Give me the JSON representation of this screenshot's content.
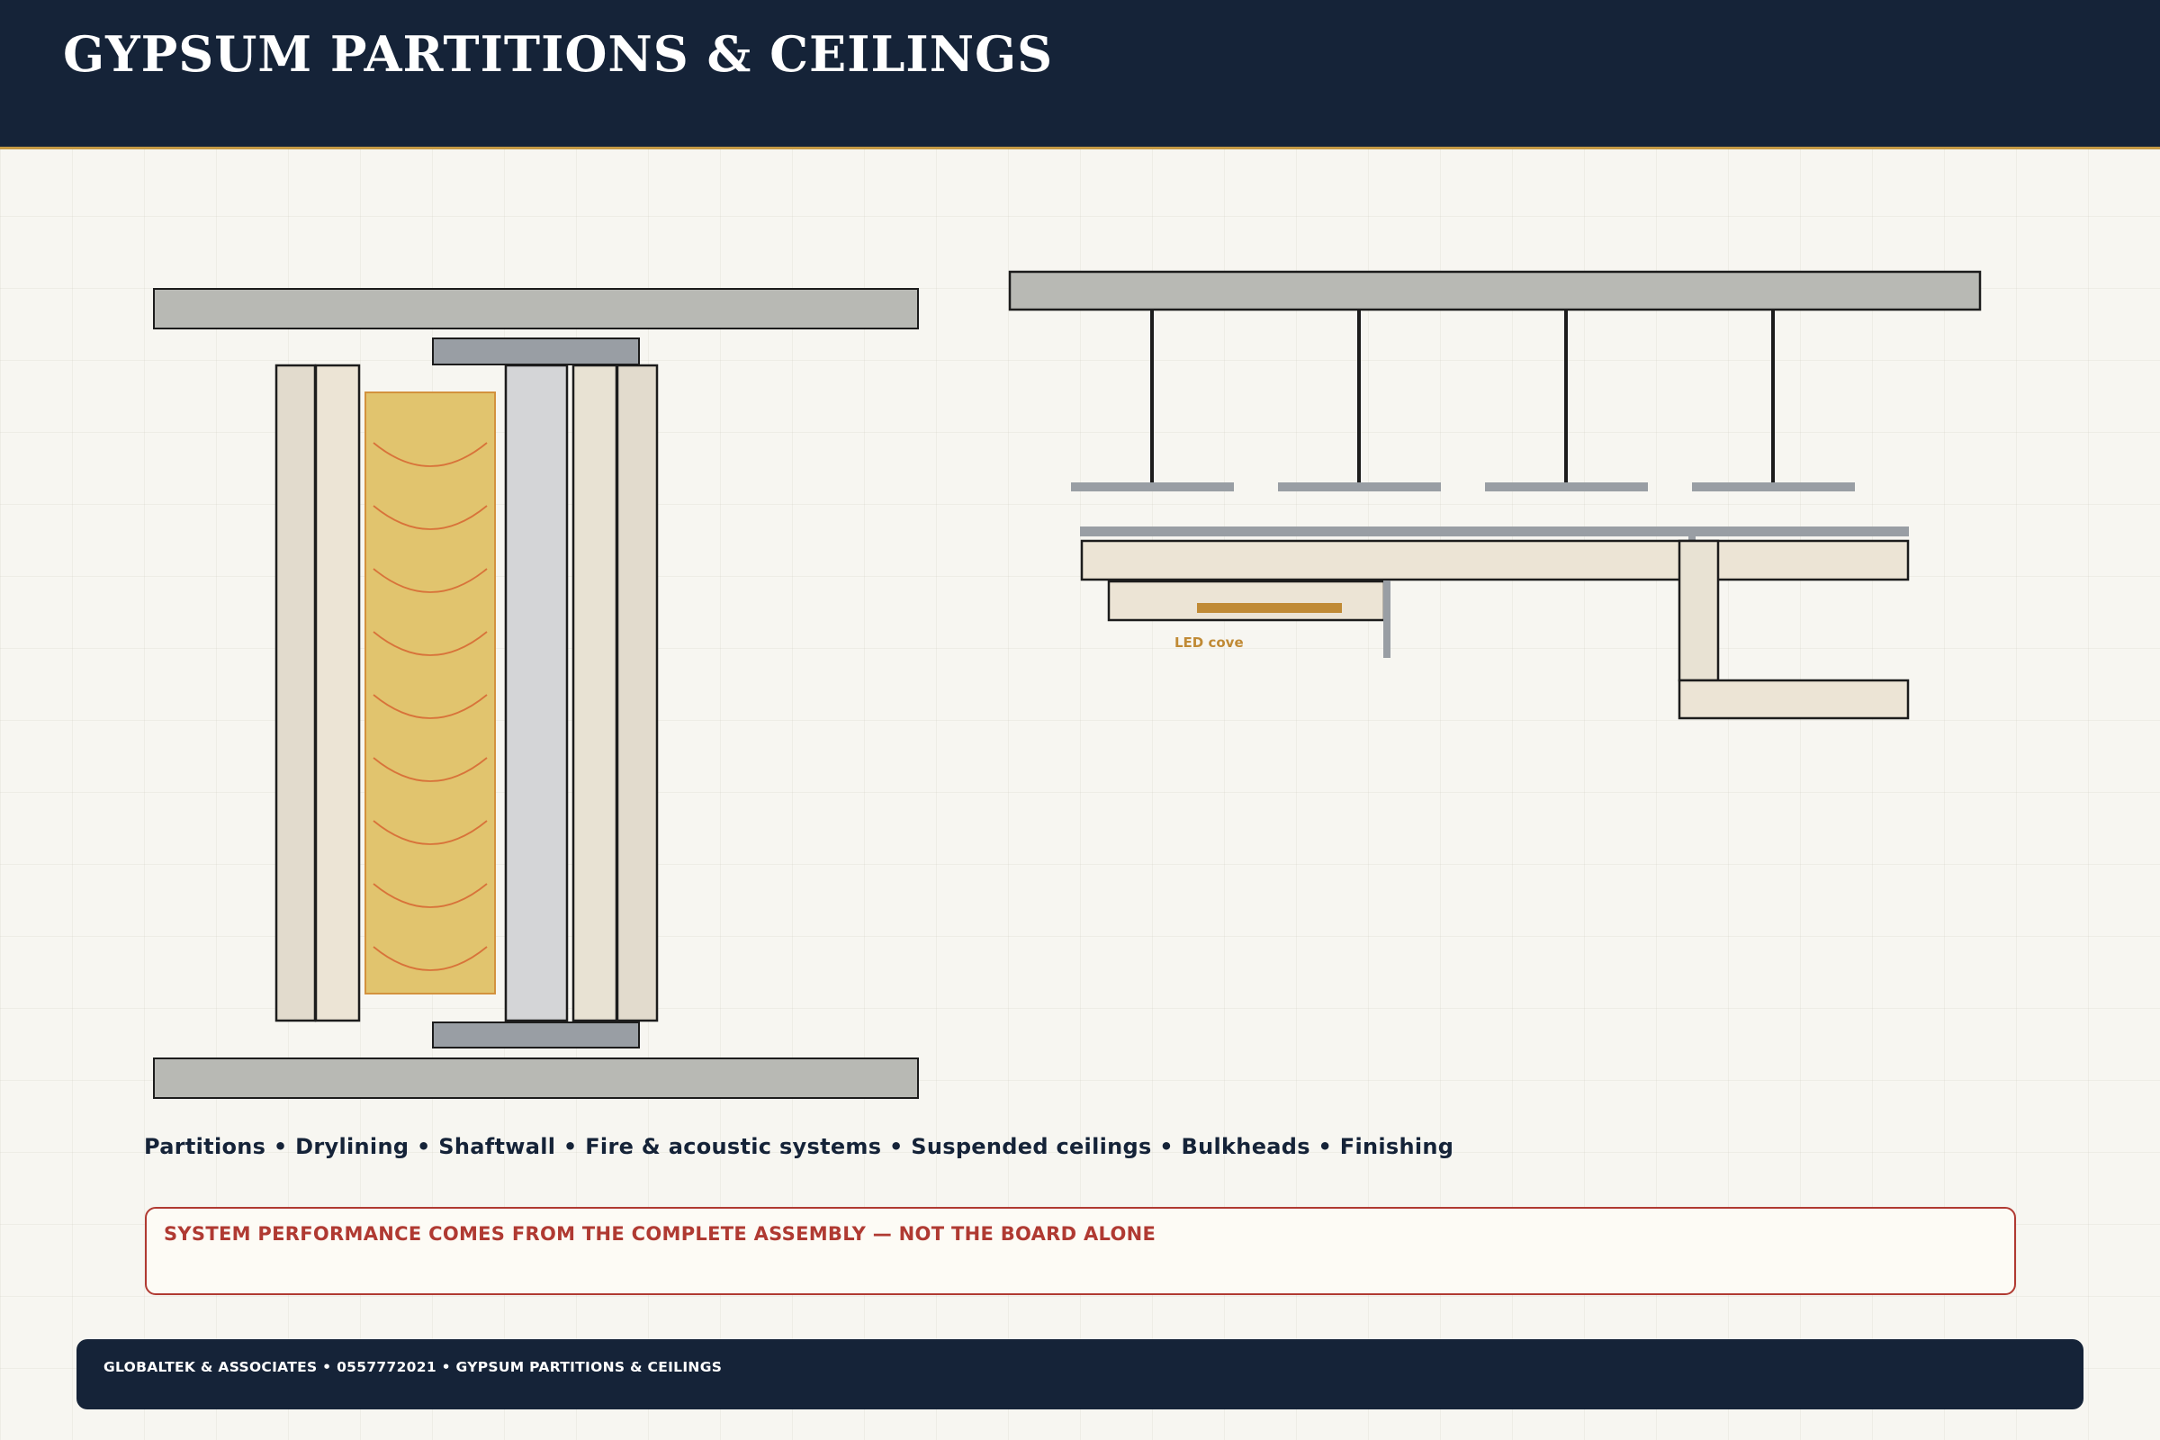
{
  "header": {
    "title": "GYPSUM PARTITIONS & CEILINGS"
  },
  "ceiling_diagram": {
    "led_label": "LED cove"
  },
  "services_line": "Partitions • Drylining • Shaftwall • Fire & acoustic systems • Suspended ceilings • Bulkheads • Finishing",
  "callout": {
    "text": "SYSTEM PERFORMANCE COMES FROM THE COMPLETE ASSEMBLY — NOT THE BOARD ALONE"
  },
  "footer": {
    "text": "GLOBALTEK & ASSOCIATES • 0557772021 • GYPSUM PARTITIONS & CEILINGS"
  },
  "colors": {
    "navy": "#152338",
    "gold_accent": "#c59a45",
    "alert_red": "#b03a32",
    "insulation": "#e1c46e",
    "board": "#ece4d5",
    "slab": "#b8b9b4",
    "metal": "#999ea4"
  }
}
